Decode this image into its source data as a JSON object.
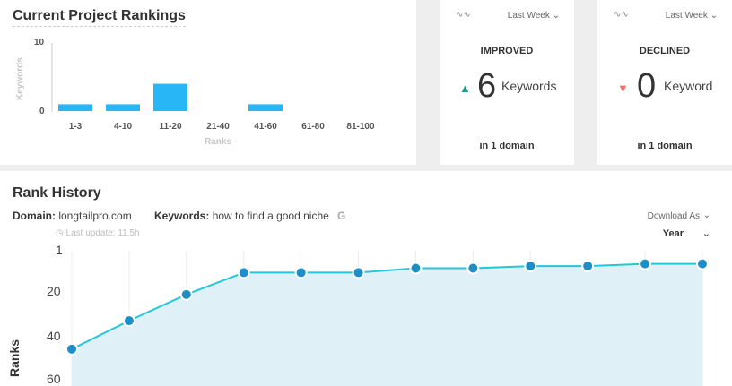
{
  "rankings": {
    "title": "Current Project Rankings",
    "ylabel": "Keywords",
    "xlabel": "Ranks",
    "yticks": [
      "10",
      "0"
    ]
  },
  "improved": {
    "period": "Last Week",
    "heading": "IMPROVED",
    "count": "6",
    "unit": "Keywords",
    "footer": "in 1 domain",
    "color": "#1aa08a"
  },
  "declined": {
    "period": "Last Week",
    "heading": "DECLINED",
    "count": "0",
    "unit": "Keyword",
    "footer": "in 1 domain",
    "color": "#f07070"
  },
  "history": {
    "title": "Rank History",
    "domain_label": "Domain:",
    "domain_value": "longtailpro.com",
    "keywords_label": "Keywords:",
    "keywords_value": "how to find a good niche",
    "last_update": "Last update: 11.5h",
    "download_label": "Download As",
    "period_select": "Year",
    "ylabel": "Ranks",
    "yticks": [
      "1",
      "20",
      "40",
      "60"
    ]
  },
  "chart_data": [
    {
      "type": "bar",
      "title": "Current Project Rankings",
      "xlabel": "Ranks",
      "ylabel": "Keywords",
      "categories": [
        "1-3",
        "4-10",
        "11-20",
        "21-40",
        "41-60",
        "61-80",
        "81-100"
      ],
      "values": [
        1,
        1,
        4,
        0,
        1,
        0,
        0
      ],
      "ylim": [
        0,
        10
      ],
      "color": "#29b6f6"
    },
    {
      "type": "area",
      "title": "Rank History",
      "ylabel": "Ranks",
      "y_inverted": true,
      "ylim": [
        1,
        60
      ],
      "values": [
        46,
        33,
        21,
        11,
        11,
        11,
        9,
        9,
        8,
        8,
        7,
        7
      ],
      "line_color": "#26c6da",
      "fill_color": "#dff0f6",
      "point_color": "#1e8fc6"
    }
  ]
}
